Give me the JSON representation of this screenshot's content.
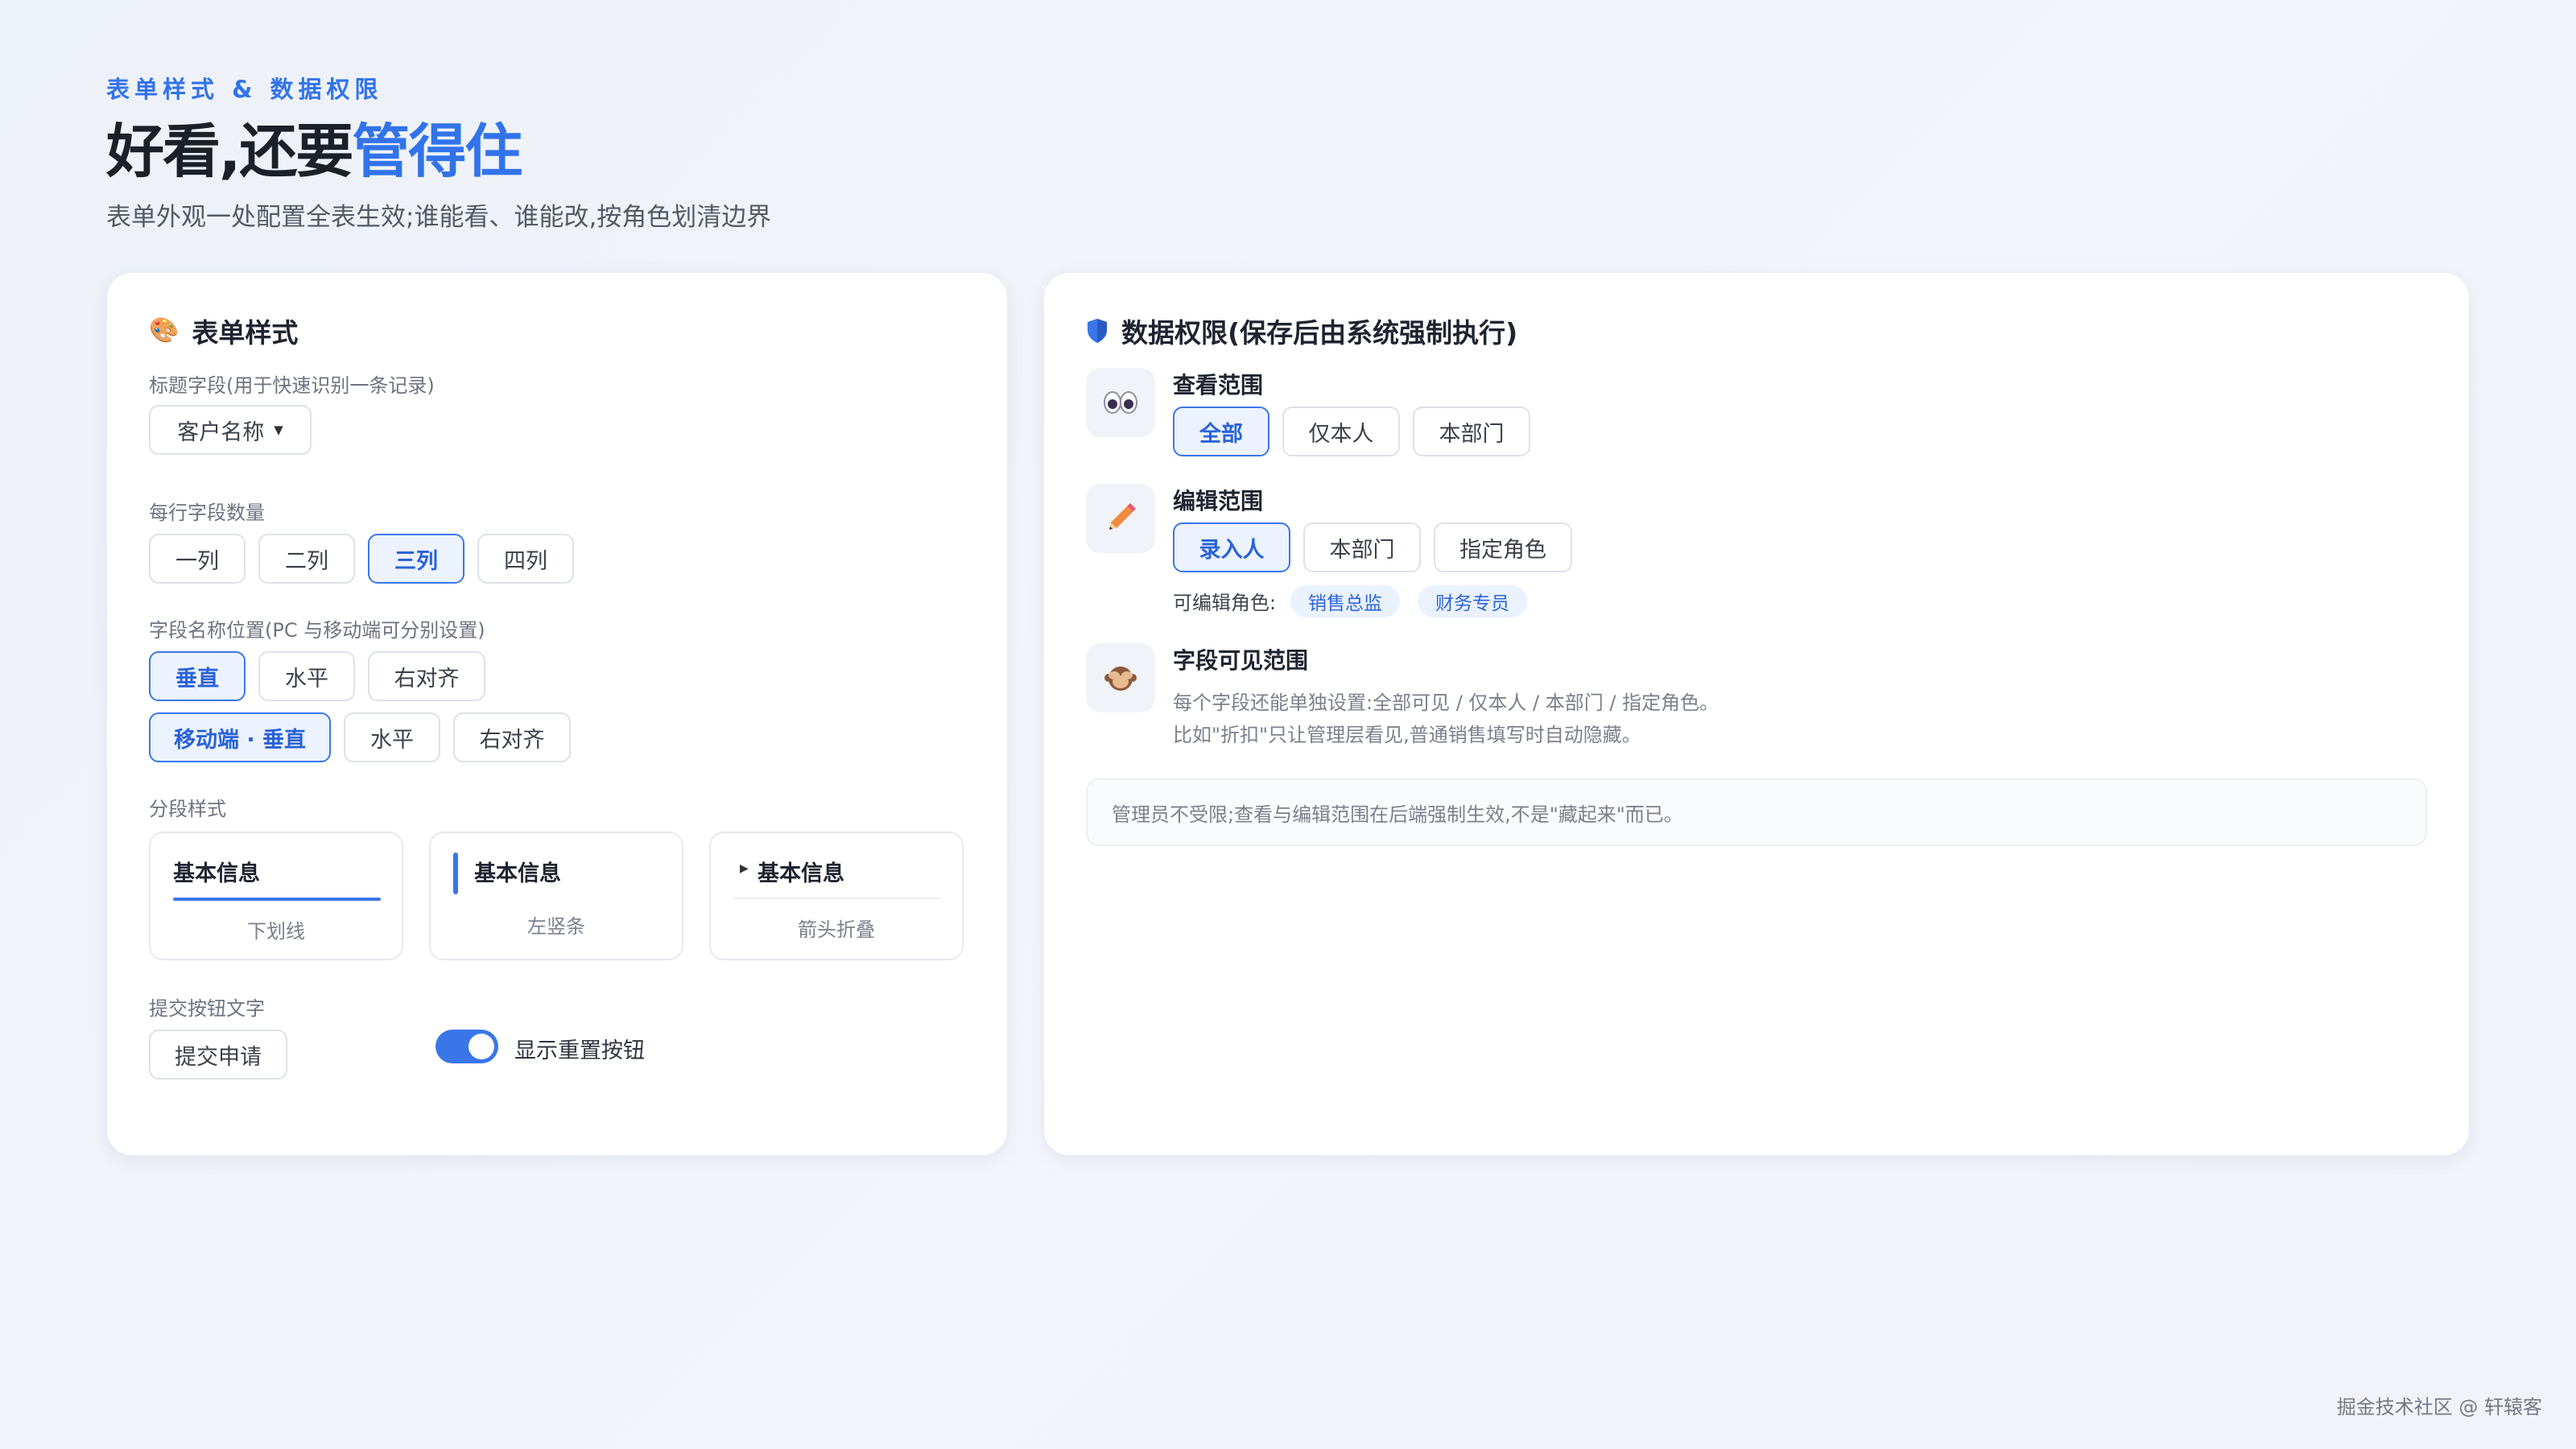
{
  "header": {
    "eyebrow": "表单样式 & 数据权限",
    "title_plain": "好看,还要",
    "title_accent": "管得住",
    "subtitle": "表单外观一处配置全表生效;谁能看、谁能改,按角色划清边界"
  },
  "form_style": {
    "title": "表单样式",
    "icon": "palette-icon",
    "title_field": {
      "label": "标题字段(用于快速识别一条记录)",
      "value": "客户名称"
    },
    "columns": {
      "label": "每行字段数量",
      "options": [
        "一列",
        "二列",
        "三列",
        "四列"
      ],
      "selected": "三列"
    },
    "label_position": {
      "label": "字段名称位置(PC 与移动端可分别设置)",
      "pc_options": [
        "垂直",
        "水平",
        "右对齐"
      ],
      "pc_selected": "垂直",
      "mobile_options": [
        "移动端 · 垂直",
        "水平",
        "右对齐"
      ],
      "mobile_selected": "移动端 · 垂直"
    },
    "section_style": {
      "label": "分段样式",
      "options": [
        {
          "title": "基本信息",
          "caption": "下划线"
        },
        {
          "title": "基本信息",
          "caption": "左竖条"
        },
        {
          "title": "基本信息",
          "caption": "箭头折叠"
        }
      ]
    },
    "submit": {
      "label": "提交按钮文字",
      "value": "提交申请",
      "reset_toggle_label": "显示重置按钮",
      "reset_toggle_on": true
    }
  },
  "data_permission": {
    "title": "数据权限(保存后由系统强制执行)",
    "icon": "shield-icon",
    "view_scope": {
      "title": "查看范围",
      "icon": "eyes-icon",
      "options": [
        "全部",
        "仅本人",
        "本部门"
      ],
      "selected": "全部"
    },
    "edit_scope": {
      "title": "编辑范围",
      "icon": "pencil-icon",
      "options": [
        "录入人",
        "本部门",
        "指定角色"
      ],
      "selected": "录入人",
      "roles_label": "可编辑角色:",
      "roles": [
        "销售总监",
        "财务专员"
      ]
    },
    "field_visibility": {
      "title": "字段可见范围",
      "icon": "see-no-evil-icon",
      "desc_line1": "每个字段还能单独设置:全部可见 / 仅本人 / 本部门 / 指定角色。",
      "desc_line2": "比如\"折扣\"只让管理层看见,普通销售填写时自动隐藏。"
    },
    "notice": "管理员不受限;查看与编辑范围在后端强制生效,不是\"藏起来\"而已。"
  },
  "footer": "掘金技术社区 @ 轩辕客",
  "colors": {
    "accent": "#3273ea",
    "chip_bg": "#eaf2ff"
  }
}
